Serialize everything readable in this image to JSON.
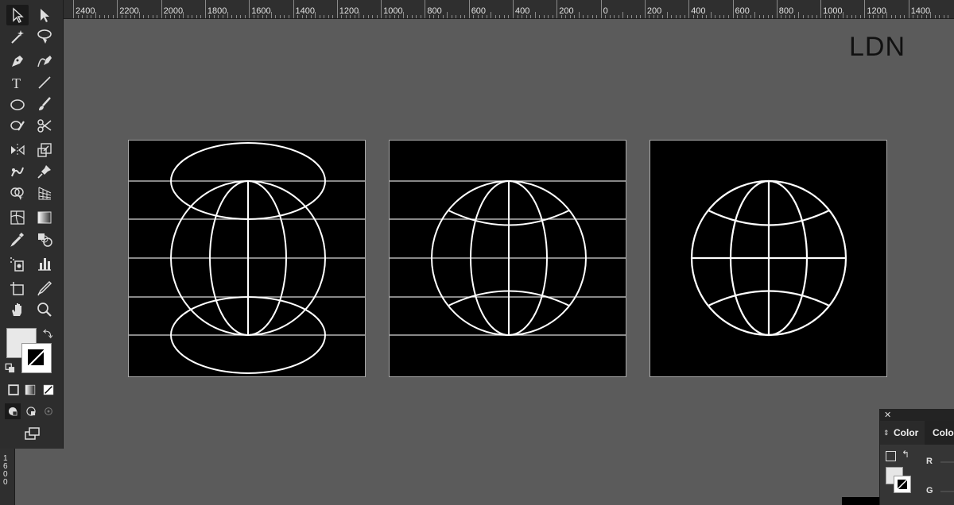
{
  "ruler": {
    "top_labels": [
      "2400",
      "2200",
      "2000",
      "1800",
      "1600",
      "1400",
      "1200",
      "1000",
      "800",
      "600",
      "400",
      "200",
      "0",
      "200",
      "400",
      "600",
      "800",
      "1000",
      "1200",
      "1400"
    ],
    "left_label": "1600"
  },
  "tools": [
    {
      "name": "selection-tool-icon",
      "glyph": "selection"
    },
    {
      "name": "direct-selection-tool-icon",
      "glyph": "direct"
    },
    {
      "name": "magic-wand-tool-icon",
      "glyph": "wand"
    },
    {
      "name": "lasso-tool-icon",
      "glyph": "lasso"
    },
    {
      "name": "pen-tool-icon",
      "glyph": "pen"
    },
    {
      "name": "curvature-tool-icon",
      "glyph": "curve"
    },
    {
      "name": "type-tool-icon",
      "glyph": "T"
    },
    {
      "name": "line-tool-icon",
      "glyph": "line"
    },
    {
      "name": "ellipse-tool-icon",
      "glyph": "ellipse"
    },
    {
      "name": "paintbrush-tool-icon",
      "glyph": "brush"
    },
    {
      "name": "shaper-tool-icon",
      "glyph": "shaper"
    },
    {
      "name": "scissors-tool-icon",
      "glyph": "scissors"
    },
    {
      "name": "reflect-tool-icon",
      "glyph": "reflect"
    },
    {
      "name": "scale-tool-icon",
      "glyph": "scale"
    },
    {
      "name": "puppet-warp-tool-icon",
      "glyph": "warp"
    },
    {
      "name": "pin-tool-icon",
      "glyph": "pin"
    },
    {
      "name": "shape-builder-tool-icon",
      "glyph": "builder"
    },
    {
      "name": "perspective-grid-tool-icon",
      "glyph": "perspective"
    },
    {
      "name": "mesh-tool-icon",
      "glyph": "mesh"
    },
    {
      "name": "gradient-tool-icon",
      "glyph": "gradient"
    },
    {
      "name": "eyedropper-tool-icon",
      "glyph": "eyedropper"
    },
    {
      "name": "blend-tool-icon",
      "glyph": "blend"
    },
    {
      "name": "symbol-sprayer-tool-icon",
      "glyph": "symbol"
    },
    {
      "name": "column-graph-tool-icon",
      "glyph": "graph"
    },
    {
      "name": "artboard-tool-icon",
      "glyph": "artboard"
    },
    {
      "name": "slice-tool-icon",
      "glyph": "slice"
    },
    {
      "name": "hand-tool-icon",
      "glyph": "hand"
    },
    {
      "name": "zoom-tool-icon",
      "glyph": "zoom"
    }
  ],
  "canvas": {
    "corner_text": "LDN"
  },
  "color_panel": {
    "tab1": "Color",
    "tab2": "Color",
    "channel_r": "R",
    "channel_g": "G"
  }
}
